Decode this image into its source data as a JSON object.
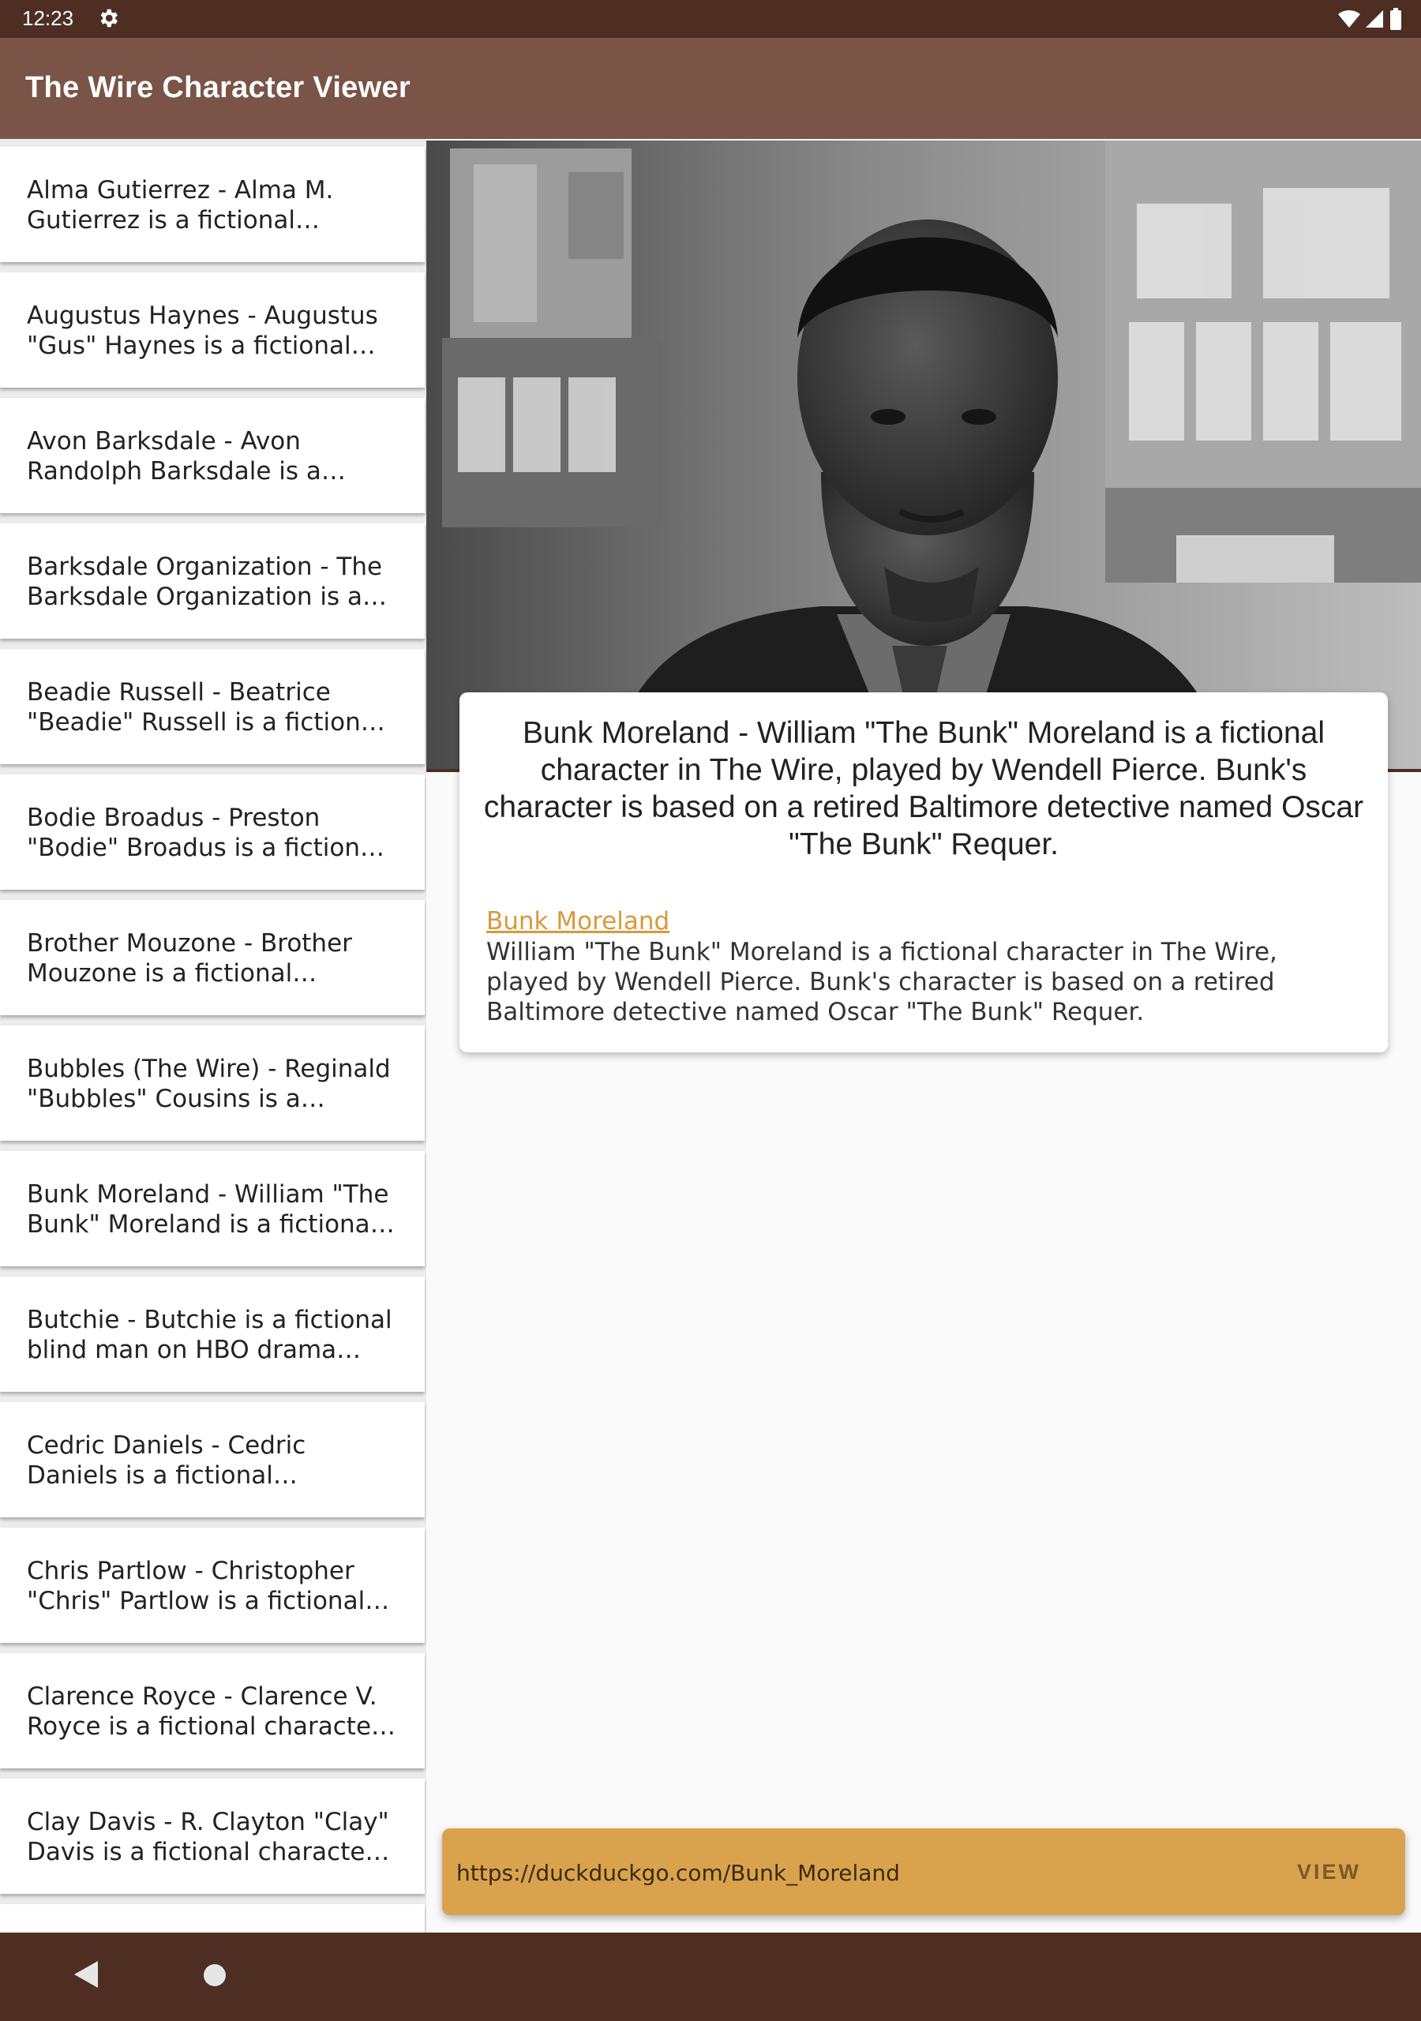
{
  "status_bar": {
    "time": "12:23",
    "icons": [
      "gear-icon",
      "wifi-icon",
      "signal-icon",
      "battery-icon"
    ]
  },
  "app_bar": {
    "title": "The Wire Character Viewer",
    "color": "#7a5446"
  },
  "list": {
    "items": [
      {
        "label": "Alma Gutierrez - Alma M. Gutierrez is a fictional character on the HBO drama The Wire"
      },
      {
        "label": "Augustus Haynes - Augustus \"Gus\" Haynes is a fictional character on the HBO drama The Wire"
      },
      {
        "label": "Avon Barksdale - Avon Randolph Barksdale is a fictional character on the HBO drama The Wire"
      },
      {
        "label": "Barksdale Organization - The Barksdale Organization is a fictional drug dealing organization"
      },
      {
        "label": "Beadie Russell - Beatrice \"Beadie\" Russell is a fictional character on the HBO drama The Wire"
      },
      {
        "label": "Bodie Broadus - Preston \"Bodie\" Broadus is a fictional character on the HBO drama The Wire"
      },
      {
        "label": "Brother Mouzone - Brother Mouzone is a fictional character on the HBO drama The Wire"
      },
      {
        "label": "Bubbles (The Wire) - Reginald \"Bubbles\" Cousins is a fictional character on the HBO drama"
      },
      {
        "label": "Bunk Moreland - William \"The Bunk\" Moreland is a fictional character in The Wire"
      },
      {
        "label": "Butchie - Butchie is a fictional blind man on HBO drama season one"
      },
      {
        "label": "Cedric Daniels - Cedric Daniels is a fictional character on the HBO drama The Wire"
      },
      {
        "label": "Chris Partlow - Christopher \"Chris\" Partlow is a fictional character on the HBO drama"
      },
      {
        "label": "Clarence Royce - Clarence V. Royce is a fictional character on the HBO drama The Wire"
      },
      {
        "label": "Clay Davis - R. Clayton \"Clay\" Davis is a fictional character on the HBO drama The Wire"
      }
    ]
  },
  "detail": {
    "heading": "Bunk Moreland - William \"The Bunk\" Moreland is a fictional character in The Wire, played by Wendell Pierce. Bunk's character is based on a retired Baltimore detective named Oscar \"The Bunk\" Requer.",
    "link_text": "Bunk Moreland",
    "description": "William \"The Bunk\" Moreland is a fictional character in The Wire, played by Wendell Pierce. Bunk's character is based on a retired Baltimore detective named Oscar \"The Bunk\" Requer.",
    "link_color": "#d69a3b"
  },
  "snackbar": {
    "url": "https://duckduckgo.com/Bunk_Moreland",
    "action": "VIEW",
    "color": "#d9a34d"
  },
  "nav_bar": {
    "icons": [
      "back-icon",
      "home-icon"
    ]
  }
}
